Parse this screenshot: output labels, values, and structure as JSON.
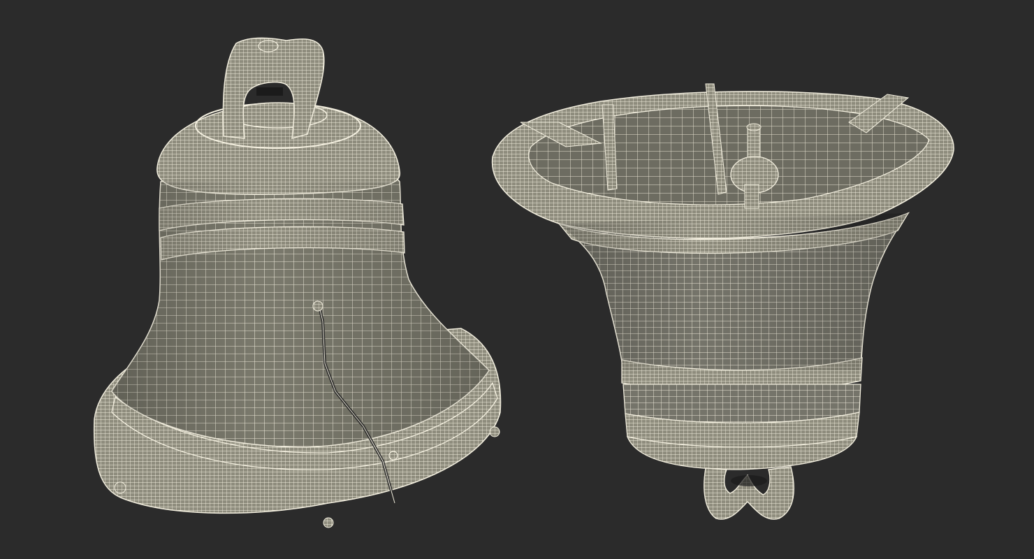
{
  "scene": {
    "background": "#2b2b2b",
    "wire_color": "#f2efdf",
    "surface_color": "#7d7c6f",
    "surface_dark": "#5f5e54",
    "models": [
      {
        "name": "bell-upright",
        "view": "upright"
      },
      {
        "name": "bell-inverted",
        "view": "inverted"
      }
    ]
  }
}
